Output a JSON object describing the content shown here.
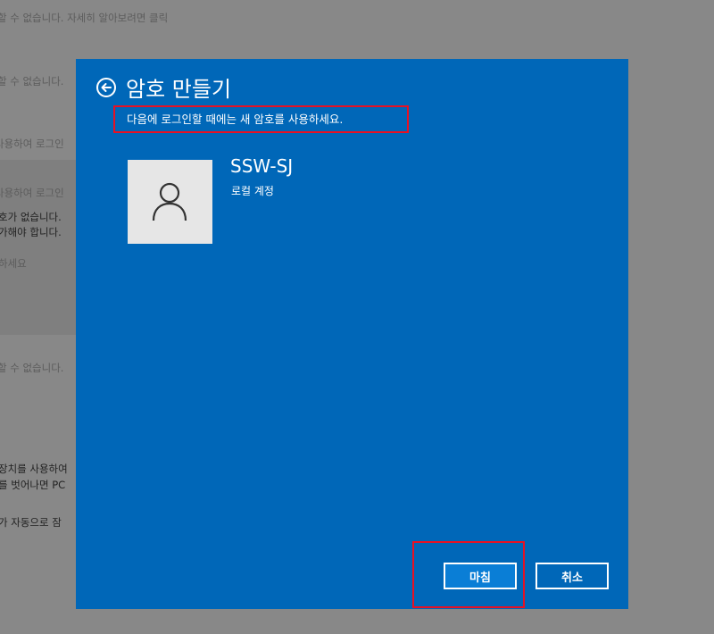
{
  "background": {
    "lines": [
      "할 수 없습니다. 자세히 알아보려면 클릭",
      "할 수 없습니다.",
      "사용하여 로그인",
      "사용하여 로그인",
      "호가 없습니다.",
      "가해야 합니다.",
      "하세요",
      "할 수 없습니다.",
      "장치를 사용하여",
      "를 벗어나면 PC",
      "가 자동으로 잠"
    ]
  },
  "dialog": {
    "title": "암호 만들기",
    "subtitle": "다음에 로그인할 때에는 새 암호를 사용하세요.",
    "account": {
      "name": "SSW-SJ",
      "type": "로컬 계정"
    },
    "buttons": {
      "finish": "마침",
      "cancel": "취소"
    }
  },
  "colors": {
    "dialog_bg": "#0067b8",
    "primary_button": "#0a7ed6",
    "highlight": "#e81123"
  }
}
